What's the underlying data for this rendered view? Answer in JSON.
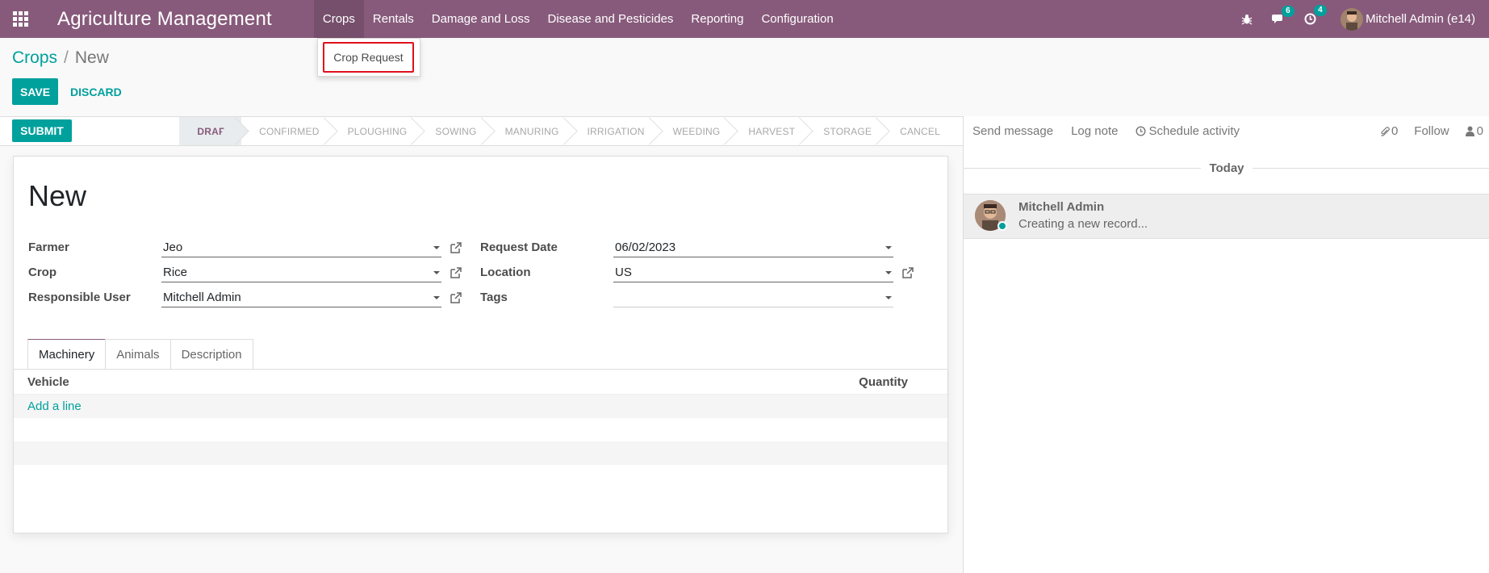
{
  "navbar": {
    "brand": "Agriculture Management",
    "menu": [
      {
        "label": "Crops"
      },
      {
        "label": "Rentals"
      },
      {
        "label": "Damage and Loss"
      },
      {
        "label": "Disease and Pesticides"
      },
      {
        "label": "Reporting"
      },
      {
        "label": "Configuration"
      }
    ],
    "messages_count": "6",
    "activities_count": "4",
    "user_name": "Mitchell Admin (e14)"
  },
  "dropdown": {
    "items": [
      {
        "label": "Crop Request"
      }
    ]
  },
  "breadcrumb": {
    "parent": "Crops",
    "separator": "/",
    "current": "New"
  },
  "control": {
    "save_label": "SAVE",
    "discard_label": "DISCARD"
  },
  "statusbar": {
    "submit_label": "SUBMIT",
    "stages": [
      "DRAFT",
      "CONFIRMED",
      "PLOUGHING",
      "SOWING",
      "MANURING",
      "IRRIGATION",
      "WEEDING",
      "HARVEST",
      "STORAGE",
      "CANCEL"
    ],
    "current_stage": "DRAFT"
  },
  "form": {
    "title": "New",
    "fields": {
      "farmer": {
        "label": "Farmer",
        "value": "Jeo"
      },
      "crop": {
        "label": "Crop",
        "value": "Rice"
      },
      "responsible_user": {
        "label": "Responsible User",
        "value": "Mitchell Admin"
      },
      "request_date": {
        "label": "Request Date",
        "value": "06/02/2023"
      },
      "location": {
        "label": "Location",
        "value": "US"
      },
      "tags": {
        "label": "Tags",
        "value": ""
      }
    },
    "tabs": [
      {
        "label": "Machinery"
      },
      {
        "label": "Animals"
      },
      {
        "label": "Description"
      }
    ],
    "table": {
      "columns": [
        "Vehicle",
        "Quantity"
      ],
      "add_line_label": "Add a line"
    }
  },
  "chatter": {
    "send_message": "Send message",
    "log_note": "Log note",
    "schedule_activity": "Schedule activity",
    "attachments_count": "0",
    "follow": "Follow",
    "followers_count": "0",
    "date_separator": "Today",
    "message": {
      "author": "Mitchell Admin",
      "body": "Creating a new record..."
    }
  },
  "colors": {
    "navbar": "#875a7b",
    "primary": "#00a09d",
    "highlight": "#e0101c"
  }
}
